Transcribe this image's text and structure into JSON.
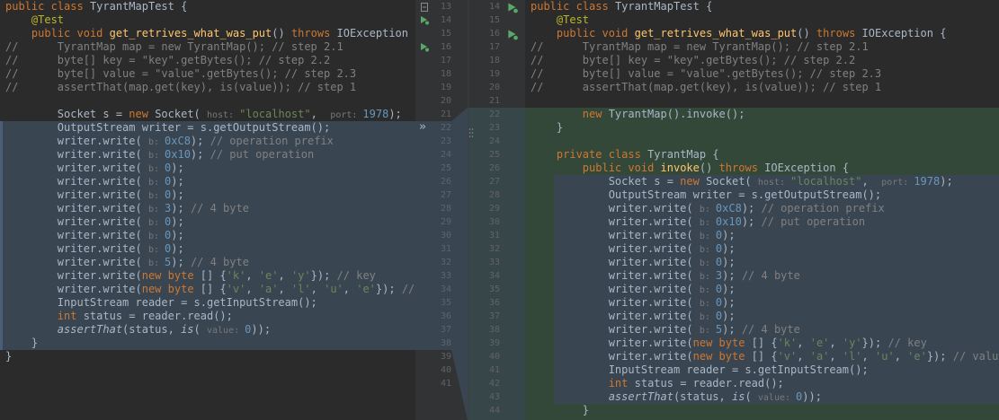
{
  "left_pane": {
    "lines": [
      "public class TyrantMapTest {",
      "    @Test",
      "    public void get_retrives_what_was_put() throws IOException {",
      "//      TyrantMap map = new TyrantMap(); // step 2.1",
      "//      byte[] key = \"key\".getBytes(); // step 2.2",
      "//      byte[] value = \"value\".getBytes(); // step 2.3",
      "//      assertThat(map.get(key), is(value)); // step 1",
      "",
      "        Socket s = new Socket( host: \"localhost\",  port: 1978);",
      "        OutputStream writer = s.getOutputStream();",
      "        writer.write( b: 0xC8); // operation prefix",
      "        writer.write( b: 0x10); // put operation",
      "        writer.write( b: 0);",
      "        writer.write( b: 0);",
      "        writer.write( b: 0);",
      "        writer.write( b: 3); // 4 byte",
      "        writer.write( b: 0);",
      "        writer.write( b: 0);",
      "        writer.write( b: 0);",
      "        writer.write( b: 5); // 4 byte",
      "        writer.write(new byte [] {'k', 'e', 'y'}); // key",
      "        writer.write(new byte [] {'v', 'a', 'l', 'u', 'e'}); // v",
      "        InputStream reader = s.getInputStream();",
      "        int status = reader.read();",
      "        assertThat(status, is( value: 0));",
      "    }",
      "}"
    ]
  },
  "right_pane": {
    "lines": [
      "public class TyrantMapTest {",
      "    @Test",
      "    public void get_retrives_what_was_put() throws IOException {",
      "//      TyrantMap map = new TyrantMap(); // step 2.1",
      "//      byte[] key = \"key\".getBytes(); // step 2.2",
      "//      byte[] value = \"value\".getBytes(); // step 2.3",
      "//      assertThat(map.get(key), is(value)); // step 1",
      "",
      "        new TyrantMap().invoke();",
      "    }",
      "",
      "    private class TyrantMap {",
      "        public void invoke() throws IOException {",
      "            Socket s = new Socket( host: \"localhost\",  port: 1978);",
      "            OutputStream writer = s.getOutputStream();",
      "            writer.write( b: 0xC8); // operation prefix",
      "            writer.write( b: 0x10); // put operation",
      "            writer.write( b: 0);",
      "            writer.write( b: 0);",
      "            writer.write( b: 0);",
      "            writer.write( b: 3); // 4 byte",
      "            writer.write( b: 0);",
      "            writer.write( b: 0);",
      "            writer.write( b: 0);",
      "            writer.write( b: 5); // 4 byte",
      "            writer.write(new byte [] {'k', 'e', 'y'}); // key",
      "            writer.write(new byte [] {'v', 'a', 'l', 'u', 'e'}); // value",
      "            InputStream reader = s.getInputStream();",
      "            int status = reader.read();",
      "            assertThat(status, is( value: 0));",
      "        }"
    ]
  },
  "gutter": {
    "left_numbers": [
      "13",
      "14",
      "15",
      "16",
      "17",
      "18",
      "19",
      "20",
      "21",
      "22",
      "23",
      "24",
      "25",
      "26",
      "27",
      "28",
      "29",
      "30",
      "31",
      "32",
      "33",
      "34",
      "35",
      "36",
      "37",
      "38",
      "39",
      "40",
      "41"
    ],
    "right_numbers": [
      "14",
      "15",
      "16",
      "17",
      "18",
      "19",
      "20",
      "21",
      "22",
      "23",
      "24",
      "25",
      "26",
      "27",
      "28",
      "29",
      "30",
      "31",
      "32",
      "33",
      "34",
      "35",
      "36",
      "37",
      "38",
      "39",
      "40",
      "41",
      "42",
      "43",
      "44"
    ],
    "apply_arrow": "»",
    "icons": [
      "run-test-icon",
      "run-method-icon",
      "fold-icon",
      "drag-handle-icon"
    ]
  },
  "colors": {
    "background": "#2b2b2b",
    "gutter": "#313335",
    "changed_block": "#3a4552",
    "inserted_block": "#34483a",
    "keyword": "#cc7832",
    "string": "#6a8759",
    "number": "#6897bb",
    "comment": "#808080",
    "method": "#ffc66d",
    "annotation": "#bbb529"
  }
}
